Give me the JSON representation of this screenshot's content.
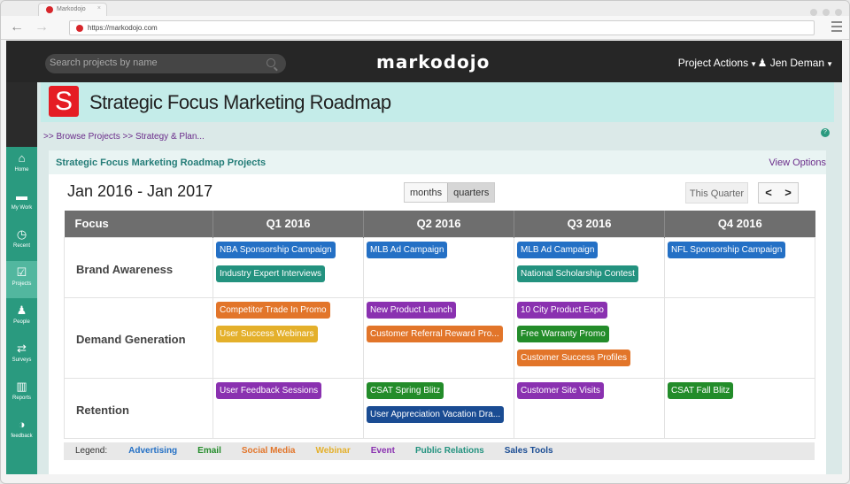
{
  "browser": {
    "tab_title": "Markodojo",
    "url": "https://markodojo.com"
  },
  "topbar": {
    "search_placeholder": "Search projects by name",
    "logo": "markodojo",
    "project_actions": "Project Actions",
    "user_name": "Jen Deman"
  },
  "sidebar": {
    "items": [
      {
        "label": "Home",
        "icon": "home-icon",
        "glyph": "⌂"
      },
      {
        "label": "My Work",
        "icon": "briefcase-icon",
        "glyph": "▬"
      },
      {
        "label": "Recent",
        "icon": "clock-icon",
        "glyph": "◷"
      },
      {
        "label": "Projects",
        "icon": "checkbox-icon",
        "glyph": "☑"
      },
      {
        "label": "People",
        "icon": "people-icon",
        "glyph": "♟"
      },
      {
        "label": "Surveys",
        "icon": "arrows-icon",
        "glyph": "⇄"
      },
      {
        "label": "Reports",
        "icon": "bar-chart-icon",
        "glyph": "▥"
      },
      {
        "label": "feedback",
        "icon": "feedback-icon",
        "glyph": "◑"
      }
    ]
  },
  "project": {
    "logo_letter": "S",
    "title": "Strategic Focus Marketing Roadmap",
    "breadcrumb": ">> Browse Projects   >> Strategy & Plan..."
  },
  "panel": {
    "title": "Strategic Focus Marketing Roadmap Projects",
    "view_options": "View Options",
    "date_range": "Jan 2016 - Jan 2017",
    "toggle_months": "months",
    "toggle_quarters": "quarters",
    "this_quarter": "This Quarter",
    "prev": "<",
    "next": ">"
  },
  "grid": {
    "columns": [
      "Focus",
      "Q1 2016",
      "Q2 2016",
      "Q3 2016",
      "Q4 2016"
    ],
    "rows": [
      {
        "focus": "Brand Awareness",
        "q1": [
          "NBA Sponsorship Campaign",
          "Industry Expert Interviews"
        ],
        "q2": [
          "MLB Ad Campaign"
        ],
        "q3": [
          "MLB Ad Campaign",
          "National Scholarship Contest"
        ],
        "q4": [
          "NFL Sponsorship Campaign"
        ]
      },
      {
        "focus": "Demand Generation",
        "q1": [
          "Competitor Trade In Promo",
          "User Success Webinars"
        ],
        "q2": [
          "New Product Launch",
          "Customer Referral Reward Pro..."
        ],
        "q3": [
          "10 City Product Expo",
          "Free Warranty Promo",
          "Customer Success Profiles"
        ],
        "q4": []
      },
      {
        "focus": "Retention",
        "q1": [
          "User Feedback Sessions"
        ],
        "q2": [
          "CSAT Spring Blitz",
          "User Appreciation Vacation Dra..."
        ],
        "q3": [
          "Customer Site Visits"
        ],
        "q4": [
          "CSAT Fall Blitz"
        ]
      }
    ]
  },
  "legend": {
    "label": "Legend:",
    "items": [
      {
        "name": "Advertising",
        "color": "#2470c5"
      },
      {
        "name": "Email",
        "color": "#238c2a"
      },
      {
        "name": "Social Media",
        "color": "#e2752a"
      },
      {
        "name": "Webinar",
        "color": "#e4b02b"
      },
      {
        "name": "Event",
        "color": "#8a31b0"
      },
      {
        "name": "Public Relations",
        "color": "#23927f"
      },
      {
        "name": "Sales Tools",
        "color": "#1a4c93"
      }
    ]
  }
}
